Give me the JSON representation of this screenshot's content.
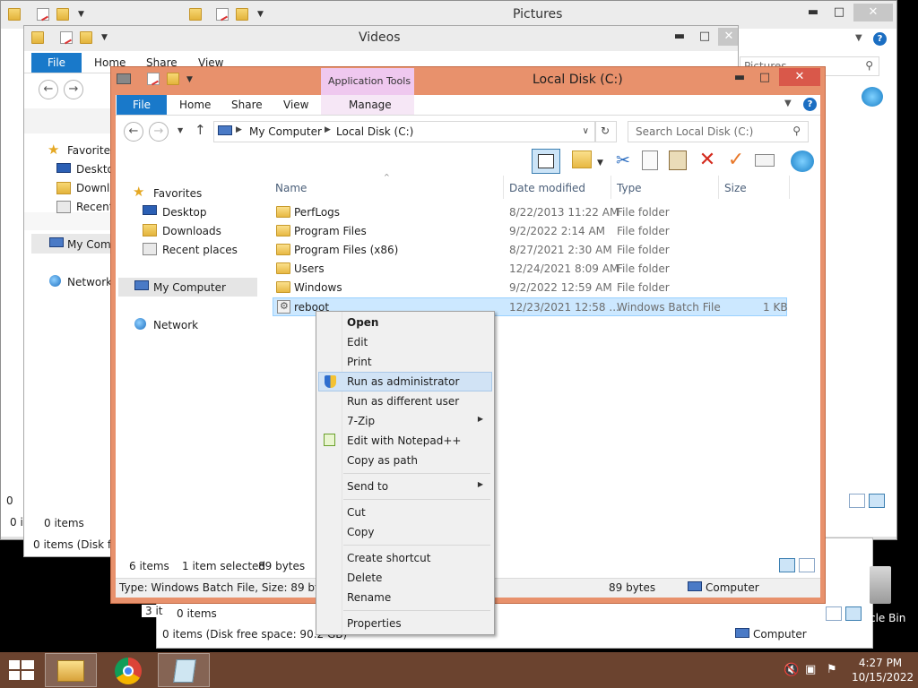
{
  "pictures_window": {
    "title": "Pictures",
    "search_partial": "Pictures",
    "status_left": "0 it",
    "status_small": "0"
  },
  "videos_window": {
    "title": "Videos",
    "tabs": [
      "File",
      "Home",
      "Share",
      "View"
    ],
    "nav": {
      "favorites": "Favorites",
      "desktop": "Deskto",
      "downloads": "Downlo",
      "recent": "Recent",
      "computer": "My Com",
      "network": "Network"
    },
    "items_count": "0 items",
    "status_bar": "0 items (Disk free"
  },
  "back_window": {
    "items_count": "0 items",
    "status_bar": "0 items (Disk free space: 90.2 GB)",
    "status_computer": "Computer",
    "left_frag": "3 it",
    "recycle_label": "cle Bin"
  },
  "main_window": {
    "title": "Local Disk (C:)",
    "contextual_tab_group": "Application Tools",
    "tabs": {
      "file": "File",
      "home": "Home",
      "share": "Share",
      "view": "View",
      "manage": "Manage"
    },
    "breadcrumb": [
      "My Computer",
      "Local Disk (C:)"
    ],
    "search_placeholder": "Search Local Disk (C:)",
    "navpane": {
      "favorites": "Favorites",
      "desktop": "Desktop",
      "downloads": "Downloads",
      "recent": "Recent places",
      "computer": "My Computer",
      "network": "Network"
    },
    "columns": {
      "name": "Name",
      "date": "Date modified",
      "type": "Type",
      "size": "Size"
    },
    "files": [
      {
        "name": "PerfLogs",
        "date": "8/22/2013 11:22 AM",
        "type": "File folder",
        "size": ""
      },
      {
        "name": "Program Files",
        "date": "9/2/2022 2:14 AM",
        "type": "File folder",
        "size": ""
      },
      {
        "name": "Program Files (x86)",
        "date": "8/27/2021 2:30 AM",
        "type": "File folder",
        "size": ""
      },
      {
        "name": "Users",
        "date": "12/24/2021 8:09 AM",
        "type": "File folder",
        "size": ""
      },
      {
        "name": "Windows",
        "date": "9/2/2022 12:59 AM",
        "type": "File folder",
        "size": ""
      },
      {
        "name": "reboot",
        "date": "12/23/2021 12:58 ...",
        "type": "Windows Batch File",
        "size": "1 KB"
      }
    ],
    "status": {
      "count": "6 items",
      "selected": "1 item selected",
      "bytes": "89 bytes"
    },
    "details_bar": {
      "text": "Type: Windows Batch File, Size: 89 bytes, D",
      "bytes": "89 bytes",
      "computer": "Computer"
    }
  },
  "context_menu": {
    "items": [
      {
        "label": "Open",
        "bold": true
      },
      {
        "label": "Edit"
      },
      {
        "label": "Print"
      },
      {
        "label": "Run as administrator",
        "icon": "uac-shield-icon",
        "highlighted": true
      },
      {
        "label": "Run as different user"
      },
      {
        "label": "7-Zip",
        "submenu": true
      },
      {
        "label": "Edit with Notepad++",
        "icon": "notepadpp-icon"
      },
      {
        "label": "Copy as path"
      },
      {
        "label": "Send to",
        "submenu": true
      },
      {
        "label": "Cut"
      },
      {
        "label": "Copy"
      },
      {
        "label": "Create shortcut"
      },
      {
        "label": "Delete"
      },
      {
        "label": "Rename"
      },
      {
        "label": "Properties"
      }
    ]
  },
  "taskbar": {
    "time": "4:27 PM",
    "date": "10/15/2022"
  },
  "colors": {
    "main_frame": "#e8916c",
    "file_tab": "#1979ca",
    "contextual_tab": "#efc8ef",
    "taskbar": "#6b432f",
    "selection": "#cce8ff"
  }
}
